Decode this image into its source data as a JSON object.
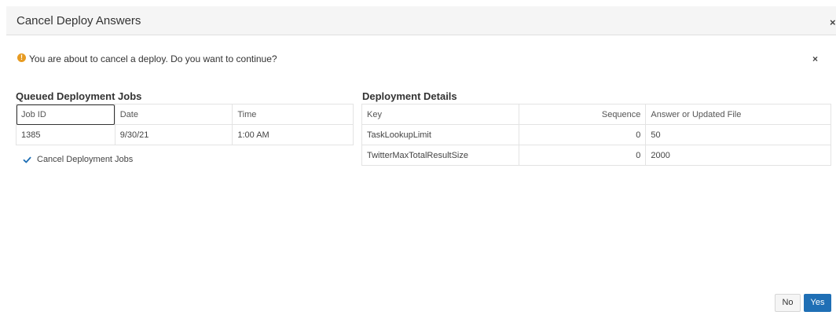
{
  "dialog": {
    "title": "Cancel Deploy Answers",
    "close_glyph": "×"
  },
  "message": {
    "icon": "warning-icon",
    "icon_glyph": "!",
    "text": "You are about to cancel a deploy. Do you want to continue?",
    "close_glyph": "×"
  },
  "queued": {
    "title": "Queued Deployment Jobs",
    "columns": [
      "Job ID",
      "Date",
      "Time"
    ],
    "rows": [
      [
        "1385",
        "9/30/21",
        "1:00 AM"
      ]
    ],
    "checkbox_label": "Cancel Deployment Jobs",
    "checkbox_checked": true
  },
  "details": {
    "title": "Deployment Details",
    "columns": [
      "Key",
      "Sequence",
      "Answer or Updated File"
    ],
    "rows": [
      [
        "TaskLookupLimit",
        "0",
        "50"
      ],
      [
        "TwitterMaxTotalResultSize",
        "0",
        "2000"
      ]
    ]
  },
  "buttons": {
    "no_label": "No",
    "yes_label": "Yes"
  },
  "colors": {
    "accent": "#1f6fb5",
    "warning": "#e79b22"
  }
}
